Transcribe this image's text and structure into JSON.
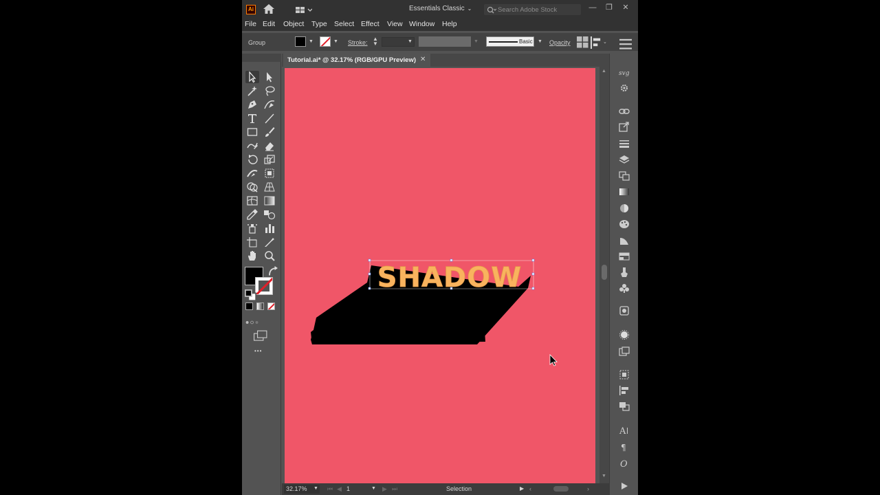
{
  "app": {
    "logo": "Ai",
    "workspace": "Essentials Classic",
    "stock_search_placeholder": "Search Adobe Stock",
    "window_controls": [
      "—",
      "❐",
      "✕"
    ]
  },
  "menu": [
    "File",
    "Edit",
    "Object",
    "Type",
    "Select",
    "Effect",
    "View",
    "Window",
    "Help"
  ],
  "control_bar": {
    "selection_label": "Group",
    "stroke_label": "Stroke:",
    "brush_label": "Basic",
    "opacity_label": "Opacity"
  },
  "document": {
    "tab_title": "Tutorial.ai* @ 32.17% (RGB/GPU Preview)",
    "close_glyph": "✕"
  },
  "artwork": {
    "text": "SHADOW",
    "text_color": "#f9b35e",
    "shadow_color": "#000000",
    "artboard_color": "#f05668"
  },
  "status_bar": {
    "zoom": "32.17%",
    "artboard_number": "1",
    "current_tool": "Selection"
  },
  "tools_panel": {
    "fill_color": "#000000",
    "stroke_color": "none",
    "more_label": "•••"
  }
}
